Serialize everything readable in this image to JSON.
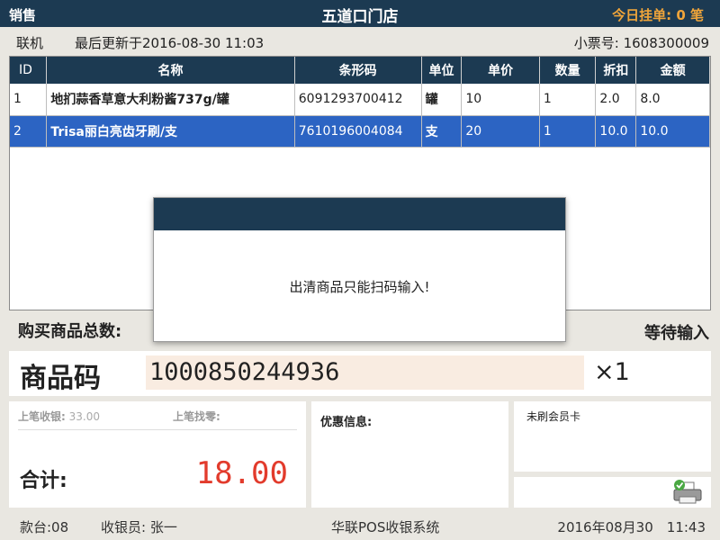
{
  "header": {
    "section": "销售",
    "store": "五道口门店",
    "pending_label": "今日挂单:",
    "pending_count": "0",
    "pending_unit": "笔"
  },
  "status": {
    "mode": "联机",
    "last_update": "最后更新于2016-08-30 11:03",
    "receipt_label": "小票号:",
    "receipt_no": "1608300009"
  },
  "table": {
    "columns": [
      "ID",
      "名称",
      "条形码",
      "单位",
      "单价",
      "数量",
      "折扣",
      "金额"
    ],
    "rows": [
      {
        "id": "1",
        "name": "地扪蒜香草意大利粉酱737g/罐",
        "barcode": "6091293700412",
        "unit": "罐",
        "price": "10",
        "qty": "1",
        "discount": "2.0",
        "amount": "8.0"
      },
      {
        "id": "2",
        "name": "Trisa丽白亮齿牙刷/支",
        "barcode": "7610196004084",
        "unit": "支",
        "price": "20",
        "qty": "1",
        "discount": "10.0",
        "amount": "10.0"
      }
    ],
    "selected_row": 2
  },
  "summary": {
    "total_items_label": "购买商品总数:",
    "status": "等待输入"
  },
  "input": {
    "label": "商品码",
    "value": "1000850244936",
    "multiplier": "×1"
  },
  "payment": {
    "prev_received_label": "上笔收银:",
    "prev_received": "33.00",
    "prev_change_label": "上笔找零:",
    "total_label": "合计:",
    "total": "18.00"
  },
  "promo": {
    "label": "优惠信息:"
  },
  "member": {
    "label": "未刷会员卡"
  },
  "footer": {
    "terminal": "款台:08",
    "cashier": "收银员: 张一",
    "system": "华联POS收银系统",
    "datetime": "2016年08月30　11:43"
  },
  "dialog": {
    "message": "出清商品只能扫码输入!"
  },
  "colors": {
    "header_bg": "#1c3a52",
    "pending_accent": "#f0a53a",
    "selected_row": "#2c64c3",
    "total": "#e23b2c",
    "input_bg": "#f9ece1"
  }
}
